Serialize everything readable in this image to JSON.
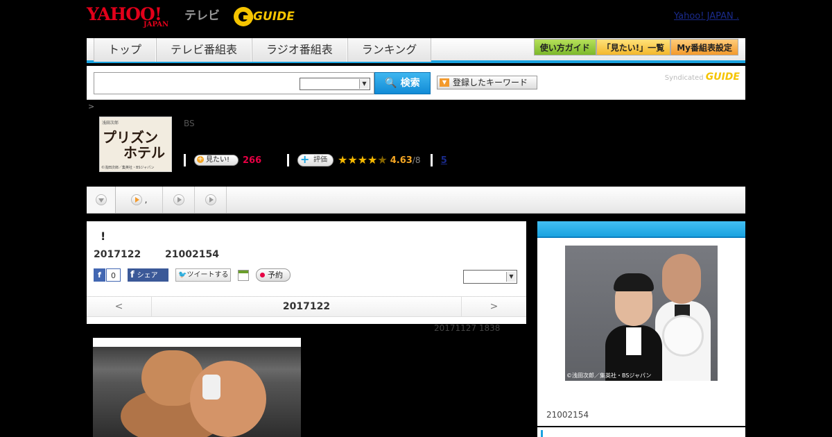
{
  "header": {
    "yahoo_logo": "YAHOO!",
    "yahoo_japan": "JAPAN",
    "tv_label": "テレビ",
    "gguide_logo": "GUIDE",
    "yahoo_japan_link": "Yahoo! JAPAN"
  },
  "nav": {
    "tabs": [
      "トップ",
      "テレビ番組表",
      "ラジオ番組表",
      "ランキング"
    ],
    "guide_button": "使い方ガイド",
    "mitai_list_button": "「見たい!」一覧",
    "my_schedule_button": "My番組表設定"
  },
  "search": {
    "placeholder": "",
    "select_value": "",
    "button_label": "検索",
    "keyword_button": "登録したキーワード",
    "syndicated": "Syndicated",
    "gguide": "GUIDE"
  },
  "breadcrumb": ">",
  "program": {
    "thumb_caption": "浅田次郎",
    "thumb_title_line1": "プリズン",
    "thumb_title_line2": "ホテル",
    "thumb_copyright": "©浅田次郎／集英社・BSジャパン",
    "channel": "BS",
    "mitai_label": "見たい!",
    "mitai_count": "266",
    "hyoka_label": "評価",
    "rating": 4.63,
    "rating_text": "4.63",
    "rating_denominator": "/8",
    "stars_full": 4,
    "stars_half": 1,
    "comment_count": "5"
  },
  "subtabs": {
    "second_label": ","
  },
  "main": {
    "title": "!",
    "date": "2017122",
    "time": "21002154",
    "fb_like_count": "0",
    "fb_share": "シェア",
    "tweet": "ツイートする",
    "reserve": "予約",
    "select_value": "",
    "prev": "<",
    "current_date": "2017122",
    "next": ">",
    "updated": "20171127  1838"
  },
  "side": {
    "photo_copyright": "©浅田次郎／集英社・BSジャパン",
    "time": "21002154"
  },
  "colors": {
    "accent_blue": "#1aa3e0",
    "mitai_pink": "#e60044",
    "rating_orange": "#f5a623",
    "yahoo_red": "#e2001a"
  }
}
